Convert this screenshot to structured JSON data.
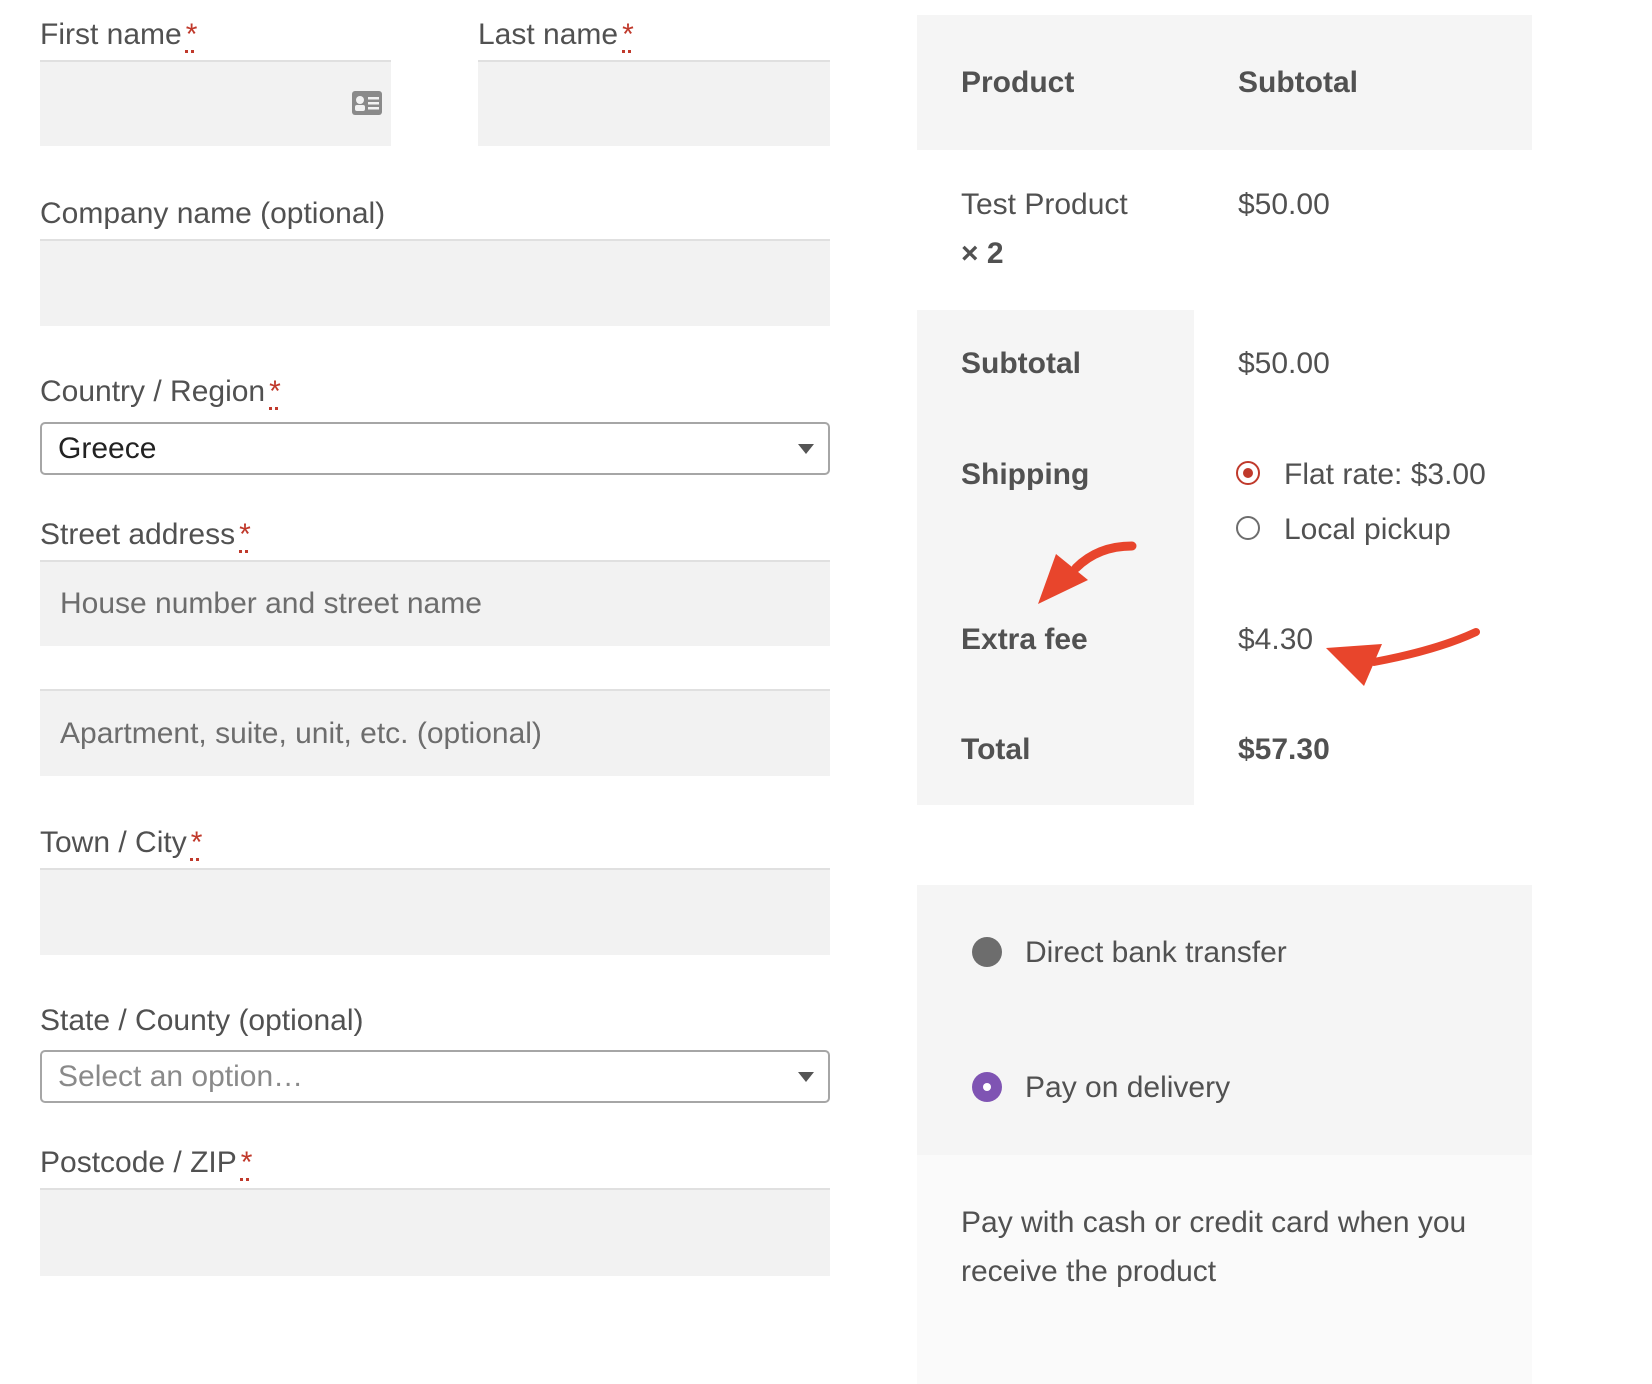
{
  "form": {
    "first_name_label": "First name",
    "last_name_label": "Last name",
    "required_mark": "*",
    "company_label": "Company name (optional)",
    "country_label": "Country / Region",
    "country_value": "Greece",
    "street_label": "Street address",
    "street_placeholder": "House number and street name",
    "apartment_placeholder": "Apartment, suite, unit, etc. (optional)",
    "city_label": "Town / City",
    "state_label": "State / County (optional)",
    "state_placeholder": "Select an option…",
    "postcode_label": "Postcode / ZIP"
  },
  "order": {
    "col_product": "Product",
    "col_subtotal": "Subtotal",
    "item_name": "Test Product",
    "item_qty": "× 2",
    "item_price": "$50.00",
    "subtotal_label": "Subtotal",
    "subtotal_value": "$50.00",
    "shipping_label": "Shipping",
    "shipping_options": [
      {
        "label": "Flat rate: $3.00",
        "selected": true
      },
      {
        "label": "Local pickup",
        "selected": false
      }
    ],
    "fee_label": "Extra fee",
    "fee_value": "$4.30",
    "total_label": "Total",
    "total_value": "$57.30"
  },
  "payment": {
    "methods": [
      {
        "label": "Direct bank transfer",
        "selected": false
      },
      {
        "label": "Pay on delivery",
        "selected": true
      }
    ],
    "description": [
      "Pay with cash or credit card when you",
      "receive the product"
    ]
  },
  "colors": {
    "accent_red": "#e8452c",
    "required": "#c0392b",
    "payment_selected": "#7f54b3"
  }
}
